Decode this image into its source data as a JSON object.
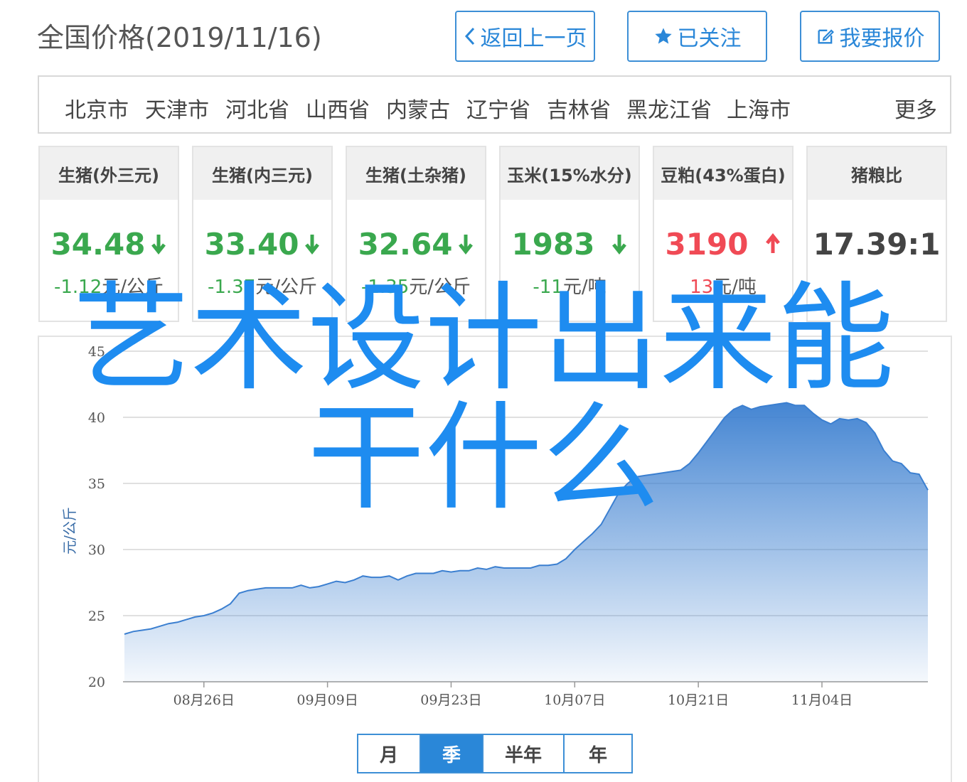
{
  "header": {
    "title": "全国价格(2019/11/16)",
    "back_label": "返回上一页",
    "follow_label": "已关注",
    "quote_label": "我要报价"
  },
  "regions": {
    "items": [
      "北京市",
      "天津市",
      "河北省",
      "山西省",
      "内蒙古",
      "辽宁省",
      "吉林省",
      "黑龙江省",
      "上海市"
    ],
    "more_label": "更多"
  },
  "cards": [
    {
      "title": "生猪(外三元)",
      "price": "34.48",
      "change": "-1.12",
      "unit": "元/公斤",
      "direction": "down"
    },
    {
      "title": "生猪(内三元)",
      "price": "33.40",
      "change": "-1.37",
      "unit": "元/公斤",
      "direction": "down"
    },
    {
      "title": "生猪(土杂猪)",
      "price": "32.64",
      "change": "-1.35",
      "unit": "元/公斤",
      "direction": "down"
    },
    {
      "title": "玉米(15%水分)",
      "price": "1983",
      "change": "-11",
      "unit": "元/吨",
      "direction": "down"
    },
    {
      "title": "豆粕(43%蛋白)",
      "price": "3190",
      "change": "13",
      "unit": "元/吨",
      "direction": "up"
    },
    {
      "title": "猪粮比",
      "price": "17.39:1",
      "change": "",
      "unit": "",
      "direction": "none"
    }
  ],
  "colors": {
    "accent": "#2a87d8",
    "down": "#3aa84e",
    "up": "#f04a55",
    "line": "#3b7fd0",
    "overlay": "#1e8cf0"
  },
  "chart_data": {
    "type": "area",
    "ylabel": "元/公斤",
    "ylim": [
      20,
      45
    ],
    "yticks": [
      20,
      25,
      30,
      35,
      40,
      45
    ],
    "x_start": "2019-08-17",
    "x_end": "2019-11-16",
    "xticks": [
      {
        "date": "2019-08-26",
        "label": "08月26日"
      },
      {
        "date": "2019-09-09",
        "label": "09月09日"
      },
      {
        "date": "2019-09-23",
        "label": "09月23日"
      },
      {
        "date": "2019-10-07",
        "label": "10月07日"
      },
      {
        "date": "2019-10-21",
        "label": "10月21日"
      },
      {
        "date": "2019-11-04",
        "label": "11月04日"
      }
    ],
    "grid": true,
    "series": [
      {
        "points": [
          [
            "2019-08-17",
            23.6
          ],
          [
            "2019-08-18",
            23.8
          ],
          [
            "2019-08-19",
            23.9
          ],
          [
            "2019-08-20",
            24.0
          ],
          [
            "2019-08-21",
            24.2
          ],
          [
            "2019-08-22",
            24.4
          ],
          [
            "2019-08-23",
            24.5
          ],
          [
            "2019-08-24",
            24.7
          ],
          [
            "2019-08-25",
            24.9
          ],
          [
            "2019-08-26",
            25.0
          ],
          [
            "2019-08-27",
            25.2
          ],
          [
            "2019-08-28",
            25.5
          ],
          [
            "2019-08-29",
            25.9
          ],
          [
            "2019-08-30",
            26.7
          ],
          [
            "2019-08-31",
            26.9
          ],
          [
            "2019-09-01",
            27.0
          ],
          [
            "2019-09-02",
            27.1
          ],
          [
            "2019-09-03",
            27.1
          ],
          [
            "2019-09-04",
            27.1
          ],
          [
            "2019-09-05",
            27.1
          ],
          [
            "2019-09-06",
            27.3
          ],
          [
            "2019-09-07",
            27.1
          ],
          [
            "2019-09-08",
            27.2
          ],
          [
            "2019-09-09",
            27.4
          ],
          [
            "2019-09-10",
            27.6
          ],
          [
            "2019-09-11",
            27.5
          ],
          [
            "2019-09-12",
            27.7
          ],
          [
            "2019-09-13",
            28.0
          ],
          [
            "2019-09-14",
            27.9
          ],
          [
            "2019-09-15",
            27.9
          ],
          [
            "2019-09-16",
            28.0
          ],
          [
            "2019-09-17",
            27.7
          ],
          [
            "2019-09-18",
            28.0
          ],
          [
            "2019-09-19",
            28.2
          ],
          [
            "2019-09-20",
            28.2
          ],
          [
            "2019-09-21",
            28.2
          ],
          [
            "2019-09-22",
            28.4
          ],
          [
            "2019-09-23",
            28.3
          ],
          [
            "2019-09-24",
            28.4
          ],
          [
            "2019-09-25",
            28.4
          ],
          [
            "2019-09-26",
            28.6
          ],
          [
            "2019-09-27",
            28.5
          ],
          [
            "2019-09-28",
            28.7
          ],
          [
            "2019-09-29",
            28.6
          ],
          [
            "2019-09-30",
            28.6
          ],
          [
            "2019-10-01",
            28.6
          ],
          [
            "2019-10-02",
            28.6
          ],
          [
            "2019-10-03",
            28.8
          ],
          [
            "2019-10-04",
            28.8
          ],
          [
            "2019-10-05",
            28.9
          ],
          [
            "2019-10-06",
            29.3
          ],
          [
            "2019-10-07",
            30.0
          ],
          [
            "2019-10-08",
            30.6
          ],
          [
            "2019-10-09",
            31.2
          ],
          [
            "2019-10-10",
            31.9
          ],
          [
            "2019-10-11",
            33.1
          ],
          [
            "2019-10-12",
            34.3
          ],
          [
            "2019-10-13",
            35.0
          ],
          [
            "2019-10-14",
            35.5
          ],
          [
            "2019-10-15",
            35.6
          ],
          [
            "2019-10-16",
            35.7
          ],
          [
            "2019-10-17",
            35.8
          ],
          [
            "2019-10-18",
            35.9
          ],
          [
            "2019-10-19",
            36.0
          ],
          [
            "2019-10-20",
            36.5
          ],
          [
            "2019-10-21",
            37.3
          ],
          [
            "2019-10-22",
            38.2
          ],
          [
            "2019-10-23",
            39.1
          ],
          [
            "2019-10-24",
            40.0
          ],
          [
            "2019-10-25",
            40.6
          ],
          [
            "2019-10-26",
            40.9
          ],
          [
            "2019-10-27",
            40.6
          ],
          [
            "2019-10-28",
            40.8
          ],
          [
            "2019-10-29",
            40.9
          ],
          [
            "2019-10-30",
            41.0
          ],
          [
            "2019-10-31",
            41.1
          ],
          [
            "2019-11-01",
            40.9
          ],
          [
            "2019-11-02",
            40.9
          ],
          [
            "2019-11-03",
            40.3
          ],
          [
            "2019-11-04",
            39.8
          ],
          [
            "2019-11-05",
            39.5
          ],
          [
            "2019-11-06",
            39.9
          ],
          [
            "2019-11-07",
            39.8
          ],
          [
            "2019-11-08",
            39.9
          ],
          [
            "2019-11-09",
            39.6
          ],
          [
            "2019-11-10",
            38.8
          ],
          [
            "2019-11-11",
            37.5
          ],
          [
            "2019-11-12",
            36.7
          ],
          [
            "2019-11-13",
            36.5
          ],
          [
            "2019-11-14",
            35.8
          ],
          [
            "2019-11-15",
            35.7
          ],
          [
            "2019-11-16",
            34.5
          ]
        ]
      }
    ]
  },
  "range_tabs": {
    "items": [
      "月",
      "季",
      "半年",
      "年"
    ],
    "active": "季"
  },
  "overlay": {
    "line1": "艺术设计出来能",
    "line2": "干什么"
  }
}
